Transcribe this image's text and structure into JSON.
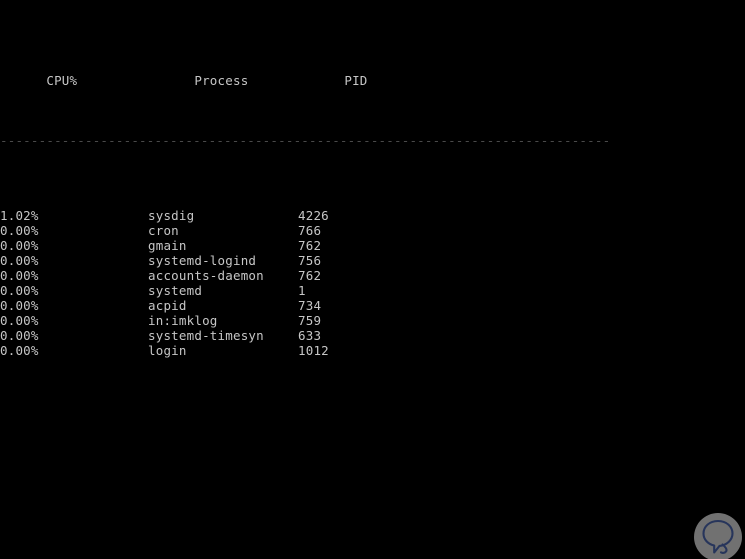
{
  "terminal": {
    "background_color": "#000000",
    "text_color": "#c6c6c6",
    "separator_color": "#4a4a4a",
    "separator": "-------------------------------------------------------------------------------",
    "columns": {
      "cpu": "CPU%",
      "process": "Process",
      "pid": "PID"
    },
    "rows": [
      {
        "cpu": "1.02%",
        "process": "sysdig",
        "pid": "4226"
      },
      {
        "cpu": "0.00%",
        "process": "cron",
        "pid": "766"
      },
      {
        "cpu": "0.00%",
        "process": "gmain",
        "pid": "762"
      },
      {
        "cpu": "0.00%",
        "process": "systemd-logind",
        "pid": "756"
      },
      {
        "cpu": "0.00%",
        "process": "accounts-daemon",
        "pid": "762"
      },
      {
        "cpu": "0.00%",
        "process": "systemd",
        "pid": "1"
      },
      {
        "cpu": "0.00%",
        "process": "acpid",
        "pid": "734"
      },
      {
        "cpu": "0.00%",
        "process": "in:imklog",
        "pid": "759"
      },
      {
        "cpu": "0.00%",
        "process": "systemd-timesyn",
        "pid": "633"
      },
      {
        "cpu": "0.00%",
        "process": "login",
        "pid": "1012"
      }
    ]
  },
  "watermark": {
    "icon": "speech-bubble-q-logo",
    "circle_color": "#7b7b7b",
    "glyph_color": "#2b3a63"
  }
}
